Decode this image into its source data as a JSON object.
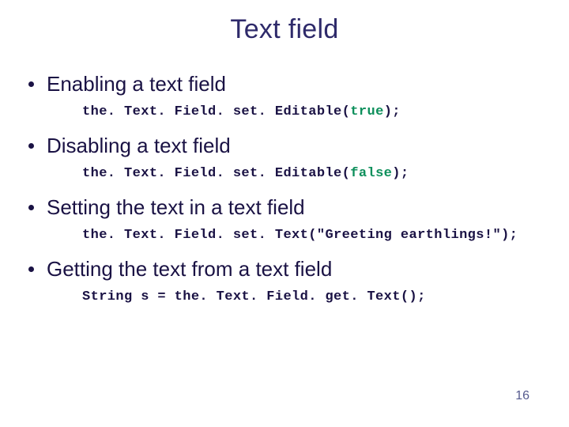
{
  "title": "Text field",
  "bullets": [
    {
      "heading": "Enabling a text field",
      "code_prefix": "the. Text. Field. set. Editable(",
      "code_keyword": "true",
      "code_suffix": ");"
    },
    {
      "heading": "Disabling a text field",
      "code_prefix": "the. Text. Field. set. Editable(",
      "code_keyword": "false",
      "code_suffix": ");"
    },
    {
      "heading": "Setting the text in a text field",
      "code_prefix": "the. Text. Field. set. Text(\"Greeting earthlings!\");",
      "code_keyword": "",
      "code_suffix": ""
    },
    {
      "heading": "Getting the text from a text field",
      "code_prefix": "String s = the. Text. Field. get. Text();",
      "code_keyword": "",
      "code_suffix": ""
    }
  ],
  "page_number": "16"
}
